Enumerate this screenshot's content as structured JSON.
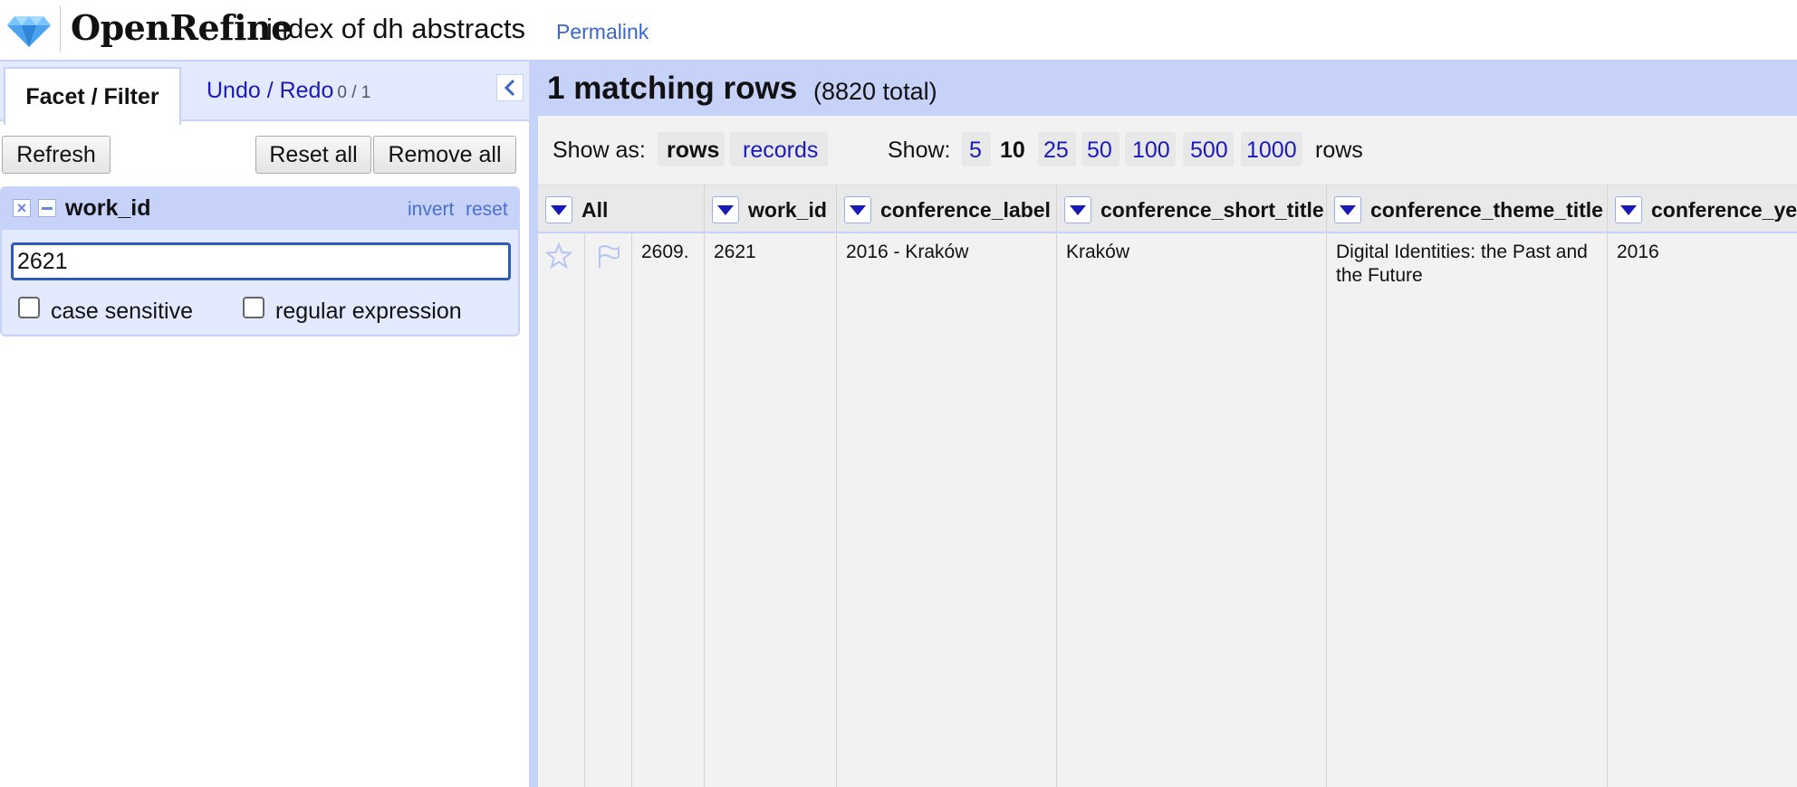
{
  "header": {
    "app_name": "OpenRefine",
    "project_name": "index of dh abstracts",
    "permalink": "Permalink"
  },
  "left_panel": {
    "tabs": {
      "facet_filter": "Facet / Filter",
      "undo_redo": "Undo / Redo",
      "undo_count": "0 / 1"
    },
    "buttons": {
      "refresh": "Refresh",
      "reset_all": "Reset all",
      "remove_all": "Remove all"
    },
    "facet": {
      "title": "work_id",
      "invert": "invert",
      "reset": "reset",
      "value": "2621",
      "case_sensitive": "case sensitive",
      "regular_expression": "regular expression"
    }
  },
  "summary": {
    "count": "1 matching rows",
    "total": "(8820 total)"
  },
  "view_bar": {
    "show_as_label": "Show as:",
    "rows": "rows",
    "records": "records",
    "show_label": "Show:",
    "page_sizes": [
      "5",
      "10",
      "25",
      "50",
      "100",
      "500",
      "1000"
    ],
    "selected_page_size": "10",
    "rows_suffix": "rows"
  },
  "grid": {
    "columns": [
      "All",
      "work_id",
      "conference_label",
      "conference_short_title",
      "conference_theme_title",
      "conference_ye"
    ],
    "row": {
      "index": "2609.",
      "work_id": "2621",
      "conference_label": "2016 - Kraków",
      "conference_short_title": "Kraków",
      "conference_theme_title": "Digital Identities: the Past and the Future",
      "conference_year": "2016"
    }
  },
  "colors": {
    "accent": "#c6d2f7",
    "link": "#1a1ab8",
    "panel_bg": "#e3e9ff"
  }
}
